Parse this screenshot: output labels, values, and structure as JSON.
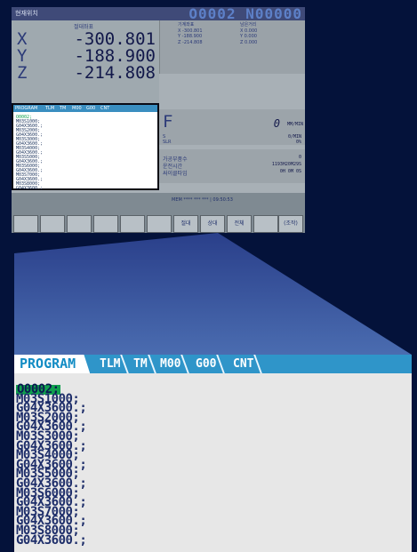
{
  "screen": {
    "title": "현재위치",
    "program_numbers": "O0002 N00000",
    "position_header": "절대좌표",
    "axes": [
      {
        "axis": "X",
        "value": "-300.801"
      },
      {
        "axis": "Y",
        "value": "-188.900"
      },
      {
        "axis": "Z",
        "value": "-214.808"
      }
    ],
    "machine_header": "기계좌표",
    "machine": [
      {
        "axis": "X",
        "value": "-300.801"
      },
      {
        "axis": "Y",
        "value": "-188.900"
      },
      {
        "axis": "Z",
        "value": "-214.808"
      }
    ],
    "remaining_header": "남은거리",
    "remaining": [
      {
        "axis": "X",
        "value": "0.000"
      },
      {
        "axis": "Y",
        "value": "0.000"
      },
      {
        "axis": "Z",
        "value": "0.000"
      }
    ],
    "feed_label": "F",
    "feed_value": "0",
    "feed_unit": "MM/MIN",
    "spindle": [
      {
        "label": "S",
        "value": "0/MIN"
      },
      {
        "label": "SLR",
        "value": "0%"
      }
    ],
    "times": [
      {
        "label": "가공부품수",
        "value": "0"
      },
      {
        "label": "운전시간",
        "value": "1193H20M29S"
      },
      {
        "label": "싸이클타임",
        "value": "0H 0M 0S"
      }
    ],
    "program_tabs": [
      "PROGRAM",
      "TLM",
      "TM",
      "M00",
      "G00",
      "CNT"
    ],
    "status_lines": [
      "MEM **** *** ***  |  09:50:53"
    ],
    "softkeys": [
      "절대",
      "상대",
      "전체",
      "(조작)"
    ]
  },
  "zoom": {
    "tabs": [
      "PROGRAM",
      "TLM",
      "TM",
      "M00",
      "G00",
      "CNT"
    ],
    "lines": [
      "O0002;",
      "M03S1000;",
      "G04X3600.;",
      "M03S2000;",
      "G04X3600.;",
      "M03S3000;",
      "G04X3600.;",
      "M03S4000;",
      "G04X3600.;",
      "M03S5000;",
      "G04X3600.;",
      "M03S6000;",
      "G04X3600.;",
      "M03S7000;",
      "G04X3600.;",
      "M03S8000;",
      "G04X3600.;"
    ]
  },
  "colors": {
    "background": "#04123a",
    "tab_bar": "#2f95c9",
    "highlight": "#11a04e",
    "text": "#1e2e6a"
  }
}
